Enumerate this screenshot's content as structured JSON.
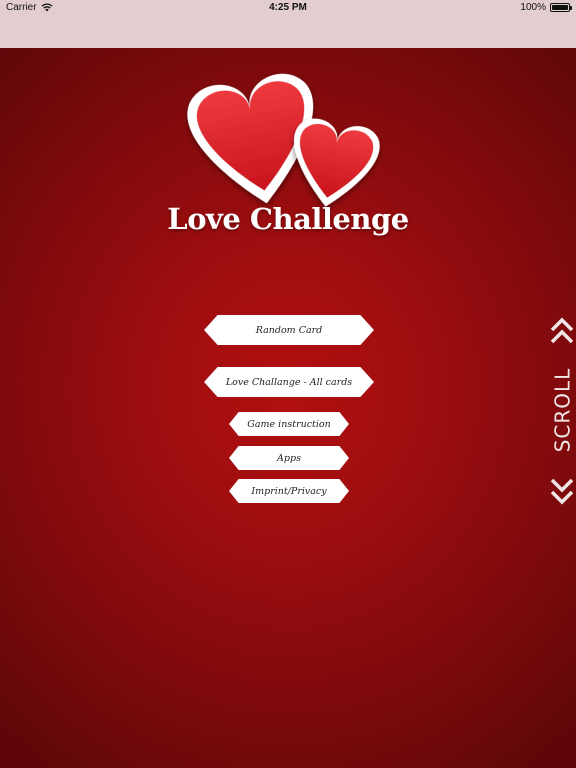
{
  "status_bar": {
    "carrier": "Carrier",
    "wifi_icon": "wifi-icon",
    "time": "4:25 PM",
    "battery_percent": "100%",
    "battery_icon": "battery-full-icon"
  },
  "app": {
    "title": "Love Challenge",
    "logo_icon": "two-hearts-icon"
  },
  "menu": {
    "random_card": "Random Card",
    "all_cards": "Love Challange - All cards",
    "game_instruction": "Game instruction",
    "apps": "Apps",
    "imprint_privacy": "Imprint/Privacy"
  },
  "scroll_indicator": {
    "label": "SCROLL",
    "up_icon": "double-chevron-up-icon",
    "down_icon": "double-chevron-down-icon"
  },
  "colors": {
    "background": "#9c0d0f",
    "status_bar": "#e3cdcf",
    "button": "#ffffff",
    "heart": "#e3202a"
  }
}
